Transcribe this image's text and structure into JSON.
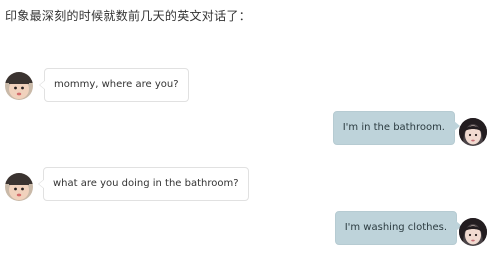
{
  "intro_text": "印象最深刻的时候就数前几天的英文对话了：",
  "messages": [
    {
      "sender": "child",
      "text": "mommy, where are you?"
    },
    {
      "sender": "mom",
      "text": "I'm in the bathroom."
    },
    {
      "sender": "child",
      "text": "what are you doing in the bathroom?"
    },
    {
      "sender": "mom",
      "text": "I'm washing clothes."
    }
  ],
  "colors": {
    "child_bubble_bg": "#ffffff",
    "child_bubble_border": "#e1e1e1",
    "mom_bubble_bg": "#bed3da"
  }
}
